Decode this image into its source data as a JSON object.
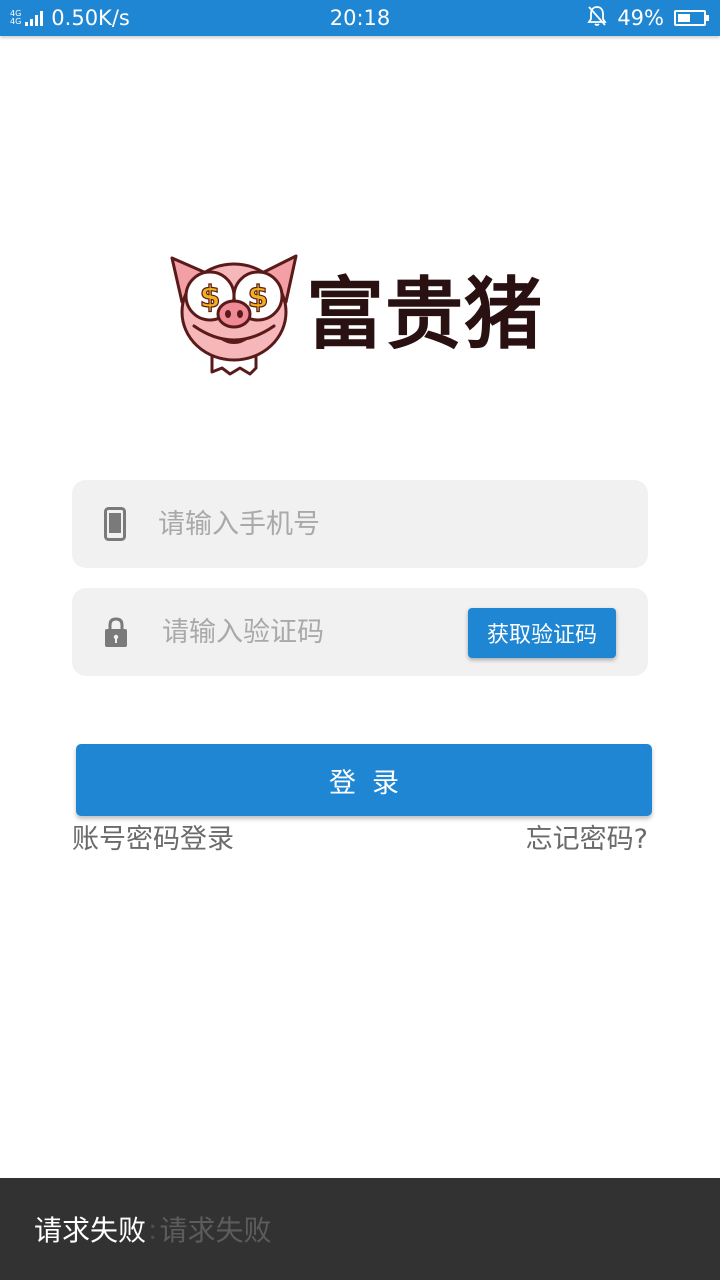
{
  "status_bar": {
    "network_label": "4G",
    "speed": "0.50K/s",
    "time": "20:18",
    "battery_percent": "49%",
    "battery_level": 0.49
  },
  "brand": {
    "name": "富贵猪"
  },
  "form": {
    "phone_placeholder": "请输入手机号",
    "code_placeholder": "请输入验证码",
    "get_code_label": "获取验证码",
    "login_label": "登录",
    "account_login_label": "账号密码登录",
    "forgot_password_label": "忘记密码?"
  },
  "snackbar": {
    "message": "请求失败",
    "separator": ":",
    "detail": "请求失败"
  },
  "colors": {
    "accent": "#1f86d3",
    "field_bg": "#f1f1f1",
    "snackbar_bg": "#323232",
    "brand_text": "#2a1111"
  }
}
